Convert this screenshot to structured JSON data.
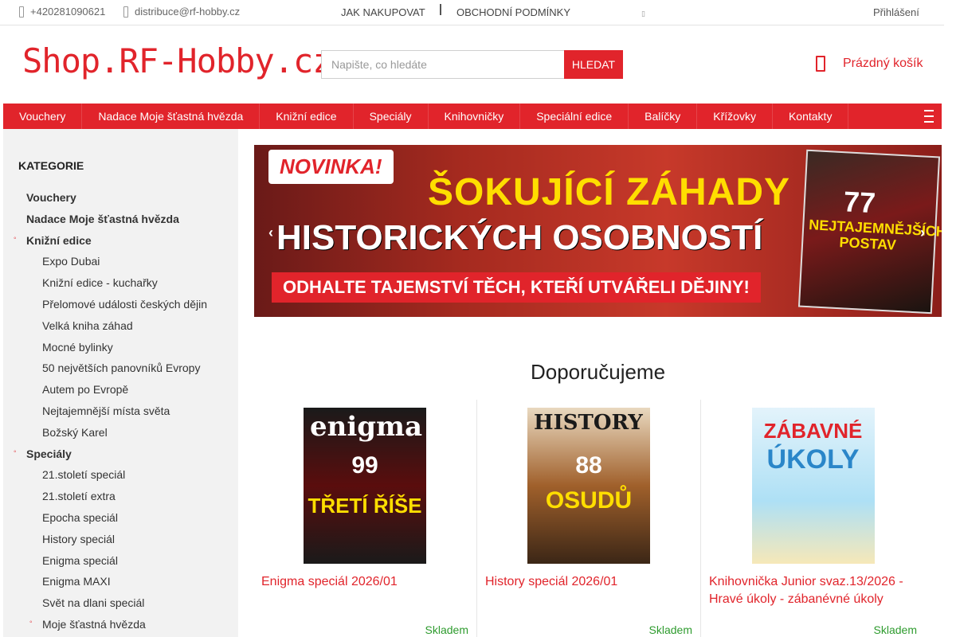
{
  "topbar": {
    "phone": "+420281090621",
    "email": "distribuce@rf-hobby.cz",
    "links": [
      "JAK NAKUPOVAT",
      "OBCHODNÍ PODMÍNKY"
    ],
    "login": "Přihlášení"
  },
  "header": {
    "logo": "Shop.RF-Hobby.cz",
    "search_placeholder": "Napište, co hledáte",
    "search_button": "HLEDAT",
    "cart": "Prázdný košík"
  },
  "nav": {
    "items": [
      "Vouchery",
      "Nadace Moje šťastná hvězda",
      "Knižní edice",
      "Speciály",
      "Knihovničky",
      "Speciální edice",
      "Balíčky",
      "Křížovky",
      "Kontakty"
    ]
  },
  "sidebar": {
    "title": "KATEGORIE",
    "items": [
      {
        "label": "Vouchery",
        "level": 0
      },
      {
        "label": "Nadace Moje šťastná hvězda",
        "level": 0
      },
      {
        "label": "Knižní edice",
        "level": 0,
        "bullet": true
      },
      {
        "label": "Expo Dubai",
        "level": 1
      },
      {
        "label": "Knižní edice - kuchařky",
        "level": 1
      },
      {
        "label": "Přelomové události českých dějin",
        "level": 1
      },
      {
        "label": "Velká kniha záhad",
        "level": 1
      },
      {
        "label": "Mocné bylinky",
        "level": 1
      },
      {
        "label": "50 největších panovníků Evropy",
        "level": 1
      },
      {
        "label": "Autem po Evropě",
        "level": 1
      },
      {
        "label": "Nejtajemnější místa světa",
        "level": 1
      },
      {
        "label": "Božský Karel",
        "level": 1
      },
      {
        "label": "Speciály",
        "level": 0,
        "bullet": true
      },
      {
        "label": "21.století speciál",
        "level": 1
      },
      {
        "label": "21.století extra",
        "level": 1
      },
      {
        "label": "Epocha speciál",
        "level": 1
      },
      {
        "label": "History speciál",
        "level": 1
      },
      {
        "label": "Enigma speciál",
        "level": 1
      },
      {
        "label": "Enigma MAXI",
        "level": 1
      },
      {
        "label": "Svět na dlani speciál",
        "level": 1
      },
      {
        "label": "Moje šťastná hvězda",
        "level": 1,
        "bullet": true
      }
    ]
  },
  "banner": {
    "badge": "NOVINKA!",
    "line1": "ŠOKUJÍCÍ ZÁHADY",
    "line2": "HISTORICKÝCH OSOBNOSTÍ",
    "line3": "ODHALTE TAJEMSTVÍ TĚCH, KTEŘÍ UTVÁŘELI DĚJINY!",
    "mag_number": "77",
    "mag_title": "NEJTAJEMNĚJŠÍCH POSTAV",
    "prev": "‹",
    "next": "›"
  },
  "recommend": {
    "title": "Doporučujeme",
    "products": [
      {
        "name": "Enigma speciál 2026/01",
        "stock": "Skladem",
        "cover_title": "enigma",
        "cover_num": "99",
        "cover_text": "TŘETÍ ŘÍŠE"
      },
      {
        "name": "History speciál 2026/01",
        "stock": "Skladem",
        "cover_title": "HISTORY",
        "cover_num": "88",
        "cover_text": "OSUDŮ"
      },
      {
        "name": "Knihovnička Junior svaz.13/2026 - Hravé úkoly - zábanévné úkoly",
        "stock": "Skladem",
        "cover_title": "ZÁBAVNÉ",
        "cover_num": "",
        "cover_text": "ÚKOLY"
      }
    ]
  },
  "colors": {
    "accent": "#e1242b",
    "stock": "#2e9b2e"
  }
}
